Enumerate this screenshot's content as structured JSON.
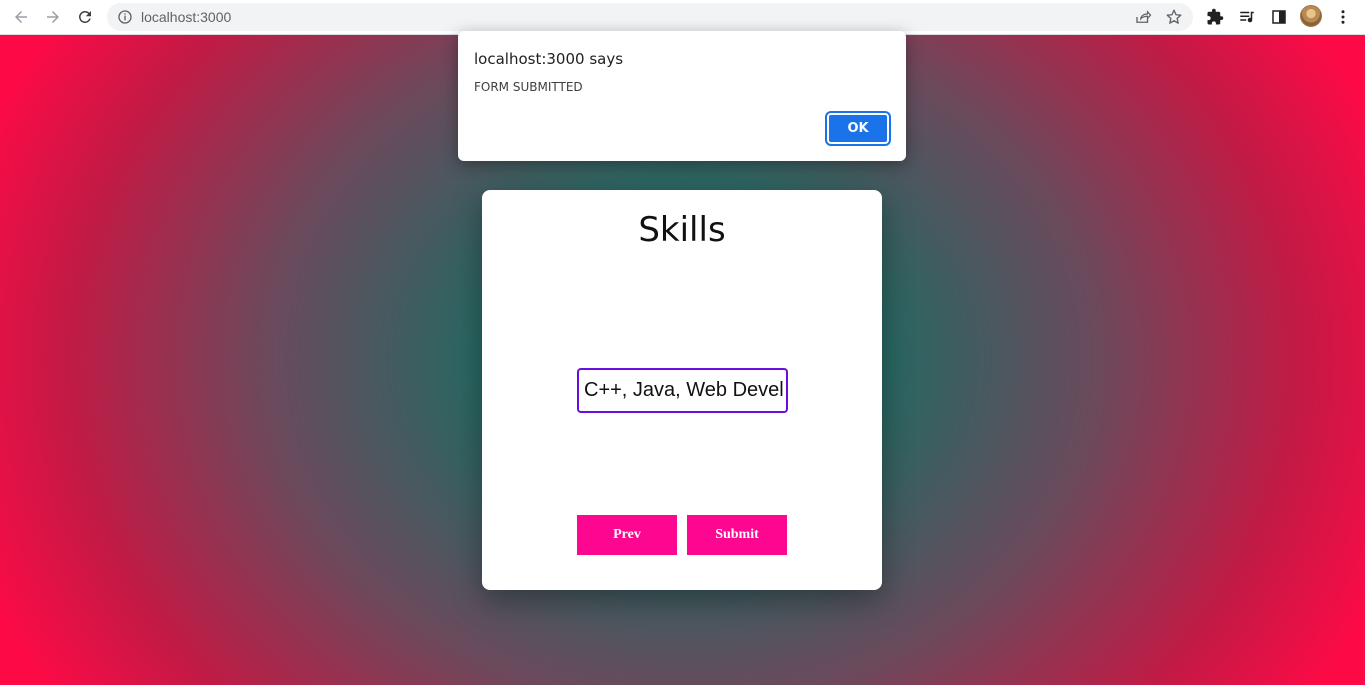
{
  "browser": {
    "url": "localhost:3000",
    "icons": {
      "back": "arrow-left-icon",
      "forward": "arrow-right-icon",
      "reload": "reload-icon",
      "site_info": "info-icon",
      "share": "share-icon",
      "bookmark": "star-icon",
      "extensions": "puzzle-icon",
      "media": "media-queue-icon",
      "side_panel": "side-panel-icon",
      "menu": "kebab-menu-icon"
    }
  },
  "alert": {
    "title": "localhost:3000 says",
    "message": "FORM SUBMITTED",
    "ok_label": "OK",
    "accent_color": "#1a73e8"
  },
  "form": {
    "title": "Skills",
    "skills_value": "C++, Java, Web Devel",
    "input_border_color": "#6a0dde",
    "prev_label": "Prev",
    "submit_label": "Submit",
    "button_color": "#fd0690"
  },
  "background": {
    "center_color": "#057a6a",
    "edge_color": "#fd0a46"
  }
}
